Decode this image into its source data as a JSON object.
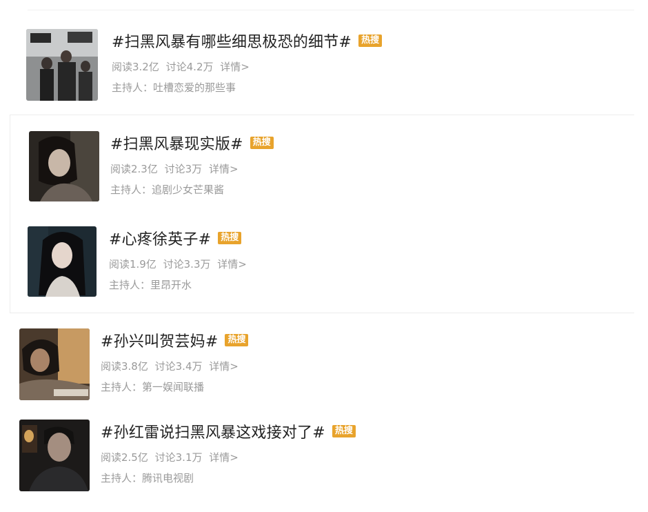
{
  "topics": [
    {
      "title": "#扫黑风暴有哪些细思极恐的细节#",
      "badge": "热搜",
      "read": "阅读3.2亿",
      "discuss": "讨论4.2万",
      "detail": "详情>",
      "host_label": "主持人：",
      "host": "吐槽恋爱的那些事"
    },
    {
      "title": "#扫黑风暴现实版#",
      "badge": "热搜",
      "read": "阅读2.3亿",
      "discuss": "讨论3万",
      "detail": "详情>",
      "host_label": "主持人：",
      "host": "追剧少女芒果酱"
    },
    {
      "title": "#心疼徐英子#",
      "badge": "热搜",
      "read": "阅读1.9亿",
      "discuss": "讨论3.3万",
      "detail": "详情>",
      "host_label": "主持人：",
      "host": "里昂开水"
    },
    {
      "title": "#孙兴叫贺芸妈#",
      "badge": "热搜",
      "read": "阅读3.8亿",
      "discuss": "讨论3.4万",
      "detail": "详情>",
      "host_label": "主持人：",
      "host": "第一娱闻联播"
    },
    {
      "title": "#孙红雷说扫黑风暴这戏接对了#",
      "badge": "热搜",
      "read": "阅读2.5亿",
      "discuss": "讨论3.1万",
      "detail": "详情>",
      "host_label": "主持人：",
      "host": "腾讯电视剧"
    }
  ],
  "colors": {
    "badge": "#e8a32c",
    "title": "#222222",
    "meta": "#9a9a9a"
  }
}
